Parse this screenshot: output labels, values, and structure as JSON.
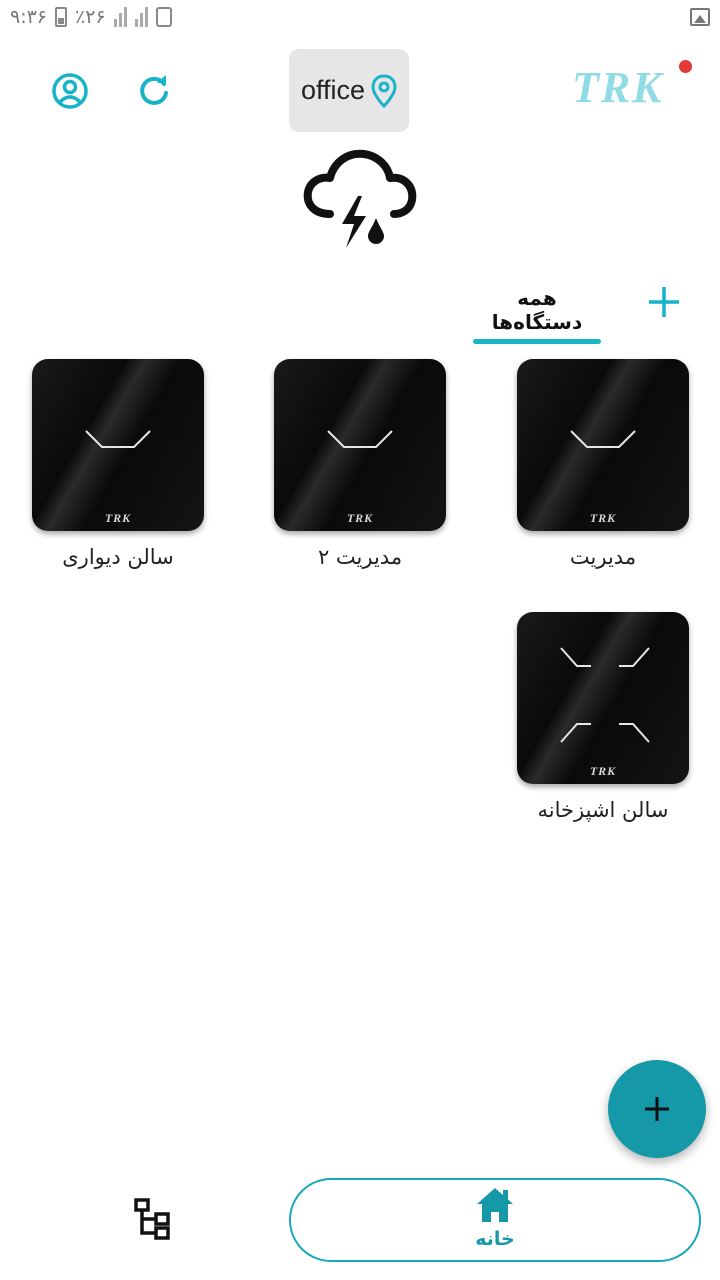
{
  "status_bar": {
    "time": "۹:۳۶",
    "battery": "٪۲۶",
    "icons": [
      "battery-icon",
      "signal-icon",
      "sim-icon",
      "gallery-icon"
    ]
  },
  "header": {
    "location": "office",
    "logo_text": "TRK",
    "icons": [
      "profile-icon",
      "refresh-icon",
      "location-pin-icon",
      "notification-dot"
    ]
  },
  "weather": {
    "icon": "thunderstorm-rain-icon"
  },
  "tabs": {
    "active_label": "همه دستگاه‌ها",
    "add_icon": "plus-icon"
  },
  "devices": [
    {
      "name": "مدیریت",
      "brand": "TRK",
      "keys": 1
    },
    {
      "name": "مدیریت ۲",
      "brand": "TRK",
      "keys": 1
    },
    {
      "name": "سالن دیواری",
      "brand": "TRK",
      "keys": 1
    },
    {
      "name": "سالن اشپزخانه",
      "brand": "TRK",
      "keys": 4
    }
  ],
  "fab": {
    "icon": "plus-icon"
  },
  "bottom_nav": {
    "home_label": "خانه",
    "home_icon": "home-icon",
    "scenes_icon": "scenes-tree-icon"
  },
  "colors": {
    "accent": "#17b3c8",
    "fab": "#1598a8",
    "tile": "#0b0b0b",
    "notification": "#e53935",
    "chip": "#e6e6e6"
  }
}
